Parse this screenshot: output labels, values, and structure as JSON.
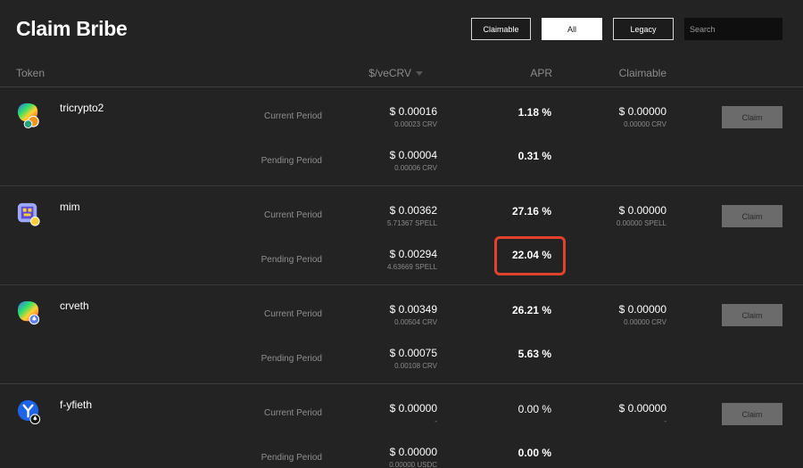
{
  "page": {
    "title": "Claim Bribe"
  },
  "filters": {
    "claimable": "Claimable",
    "all": "All",
    "legacy": "Legacy",
    "active": "All"
  },
  "search": {
    "placeholder": "Search"
  },
  "columns": {
    "token": "Token",
    "price": "$/veCRV",
    "apr": "APR",
    "claimable": "Claimable"
  },
  "claim_label": "Claim",
  "rows": [
    {
      "name": "tricrypto2",
      "icon": "tricrypto-icon",
      "current": {
        "label": "Current Period",
        "price": "$ 0.00016",
        "price_sub": "0.00023 CRV",
        "apr": "1.18 %",
        "claimable": "$ 0.00000",
        "claimable_sub": "0.00000 CRV"
      },
      "pending": {
        "label": "Pending Period",
        "price": "$ 0.00004",
        "price_sub": "0.00006 CRV",
        "apr": "0.31 %"
      }
    },
    {
      "name": "mim",
      "icon": "mim-icon",
      "current": {
        "label": "Current Period",
        "price": "$ 0.00362",
        "price_sub": "5.71367 SPELL",
        "apr": "27.16 %",
        "claimable": "$ 0.00000",
        "claimable_sub": "0.00000 SPELL"
      },
      "pending": {
        "label": "Pending Period",
        "price": "$ 0.00294",
        "price_sub": "4.63669 SPELL",
        "apr": "22.04 %"
      }
    },
    {
      "name": "crveth",
      "icon": "crveth-icon",
      "current": {
        "label": "Current Period",
        "price": "$ 0.00349",
        "price_sub": "0.00504 CRV",
        "apr": "26.21 %",
        "claimable": "$ 0.00000",
        "claimable_sub": "0.00000 CRV"
      },
      "pending": {
        "label": "Pending Period",
        "price": "$ 0.00075",
        "price_sub": "0.00108 CRV",
        "apr": "5.63 %"
      }
    },
    {
      "name": "f-yfieth",
      "icon": "yfieth-icon",
      "current": {
        "label": "Current Period",
        "price": "$ 0.00000",
        "price_sub": "-",
        "apr": "0.00 %",
        "claimable": "$ 0.00000",
        "claimable_sub": "-"
      },
      "pending": {
        "label": "Pending Period",
        "price": "$ 0.00000",
        "price_sub": "0.00000 USDC",
        "apr": "0.00 %"
      }
    }
  ],
  "colors": {
    "background": "#232323",
    "highlight": "#e0422d",
    "claim_button": "#6b6b6b"
  }
}
